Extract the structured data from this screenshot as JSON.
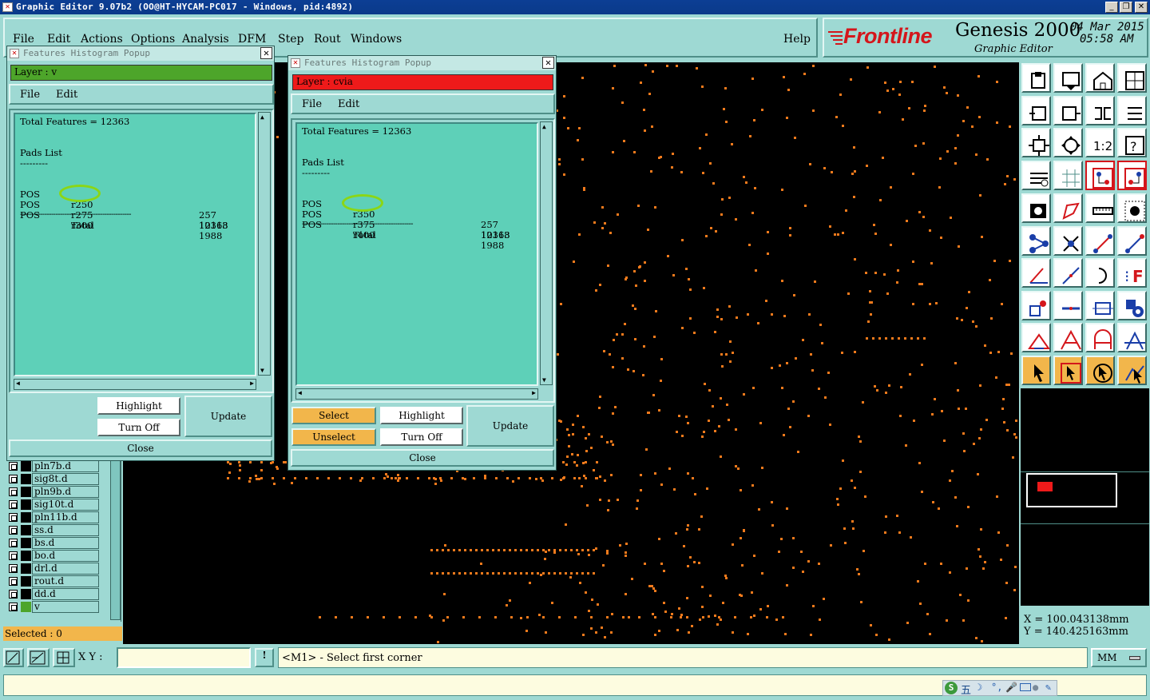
{
  "window": {
    "title": "Graphic Editor 9.07b2 (OO@HT-HYCAM-PC017 - Windows, pid:4892)"
  },
  "menubar": {
    "items": [
      "File",
      "Edit",
      "Actions",
      "Options",
      "Analysis",
      "DFM",
      "Step",
      "Rout",
      "Windows"
    ],
    "help": "Help"
  },
  "brand": {
    "logo": "Frontline",
    "product": "Genesis 2000",
    "subtitle": "Graphic Editor",
    "date": "04 Mar 2015",
    "time": "05:58 AM"
  },
  "popup1": {
    "title": "Features Histogram Popup",
    "layer_label": "Layer :  v",
    "layer_color": "#4da52a",
    "menu": [
      "File",
      "Edit"
    ],
    "total_features": "Total Features = 12363",
    "pads_heading": "Pads List",
    "pads_underline": "---------",
    "rows": [
      {
        "type": "POS",
        "sym": "r250",
        "count": "257"
      },
      {
        "type": "POS",
        "sym": "r275",
        "count": "10118"
      },
      {
        "type": "POS",
        "sym": "r300",
        "count": "1988"
      }
    ],
    "separator": "--------------------------------------------------",
    "total_label": "Total",
    "total_value": "12363",
    "buttons": {
      "highlight": "Highlight",
      "turn_off": "Turn Off",
      "update": "Update",
      "close": "Close"
    }
  },
  "popup2": {
    "title": "Features Histogram Popup",
    "layer_label": "Layer :  cvia",
    "layer_color": "#ee1a1a",
    "menu": [
      "File",
      "Edit"
    ],
    "total_features": "Total Features = 12363",
    "pads_heading": "Pads List",
    "pads_underline": "---------",
    "rows": [
      {
        "type": "POS",
        "sym": "r350",
        "count": "257"
      },
      {
        "type": "POS",
        "sym": "r375",
        "count": "10118"
      },
      {
        "type": "POS",
        "sym": "r400",
        "count": "1988"
      }
    ],
    "separator": "--------------------------------------------------",
    "total_label": "Total",
    "total_value": "12363",
    "buttons": {
      "select": "Select",
      "unselect": "Unselect",
      "highlight": "Highlight",
      "turn_off": "Turn Off",
      "update": "Update",
      "close": "Close"
    }
  },
  "layers": [
    "pln7b.d",
    "sig8t.d",
    "pln9b.d",
    "sig10t.d",
    "pln11b.d",
    "ss.d",
    "bs.d",
    "bo.d",
    "drl.d",
    "rout.d",
    "dd.d",
    "v"
  ],
  "selected_text": "Selected : 0",
  "coords": {
    "x": "X = 100.043138mm",
    "y": "Y = 140.425163mm"
  },
  "statusbar": {
    "xy_label": "X Y :",
    "xy_value": "",
    "message": "<M1> - Select first corner",
    "units": "MM"
  },
  "ime": {
    "glyph": "五"
  },
  "colors": {
    "accent_red": "#ee1a1a",
    "pad_orange": "#f07a1c",
    "panel": "#9ed9d3",
    "text_panel": "#5ed0b8"
  }
}
